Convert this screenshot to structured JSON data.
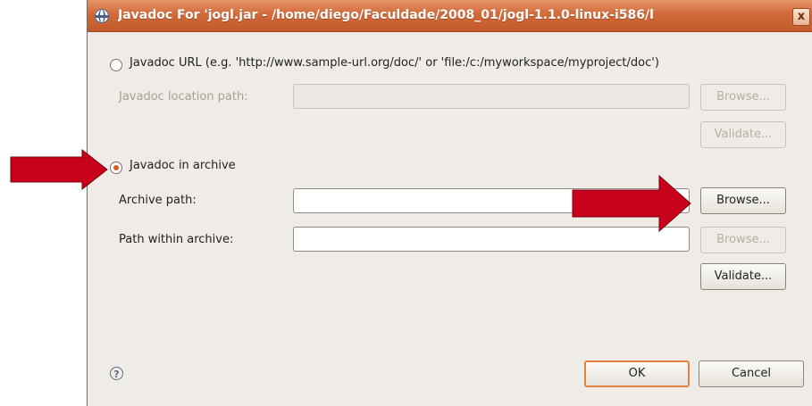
{
  "dialog": {
    "title": "Javadoc For 'jogl.jar - /home/diego/Faculdade/2008_01/jogl-1.1.0-linux-i586/l",
    "close_glyph": "x"
  },
  "url_option": {
    "label": "Javadoc URL (e.g. 'http://www.sample-url.org/doc/' or 'file:/c:/myworkspace/myproject/doc')",
    "selected": false,
    "location_label": "Javadoc location path:",
    "location_value": "",
    "browse_label": "Browse...",
    "validate_label": "Validate..."
  },
  "archive_option": {
    "label": "Javadoc in archive",
    "selected": true,
    "archive_path_label": "Archive path:",
    "archive_path_value": "",
    "browse_label": "Browse...",
    "path_within_label": "Path within archive:",
    "path_within_value": "",
    "browse2_label": "Browse...",
    "validate_label": "Validate..."
  },
  "footer": {
    "help_glyph": "?",
    "ok_label": "OK",
    "cancel_label": "Cancel"
  },
  "annotation_arrows": {
    "color": "#c8001a",
    "count": 2
  }
}
